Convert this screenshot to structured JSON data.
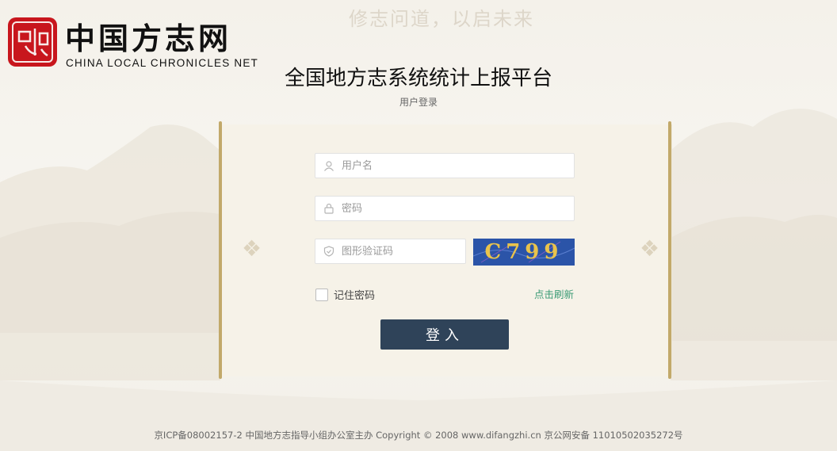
{
  "background": {
    "motto": "修志问道，以启未来"
  },
  "brand": {
    "name_cn": "中国方志网",
    "name_en": "CHINA LOCAL CHRONICLES NET",
    "seal_text": "中國方志"
  },
  "header": {
    "title": "全国地方志系统统计上报平台",
    "subtitle": "用户登录"
  },
  "form": {
    "username_placeholder": "用户名",
    "password_placeholder": "密码",
    "captcha_placeholder": "图形验证码",
    "captcha_image_text": "C799",
    "remember_label": "记住密码",
    "refresh_label": "点击刷新",
    "remember_checked": false,
    "login_label": "登入"
  },
  "footer": {
    "text": "京ICP备08002157-2 中国地方志指导小组办公室主办 Copyright © 2008 www.difangzhi.cn 京公网安备 11010502035272号"
  },
  "colors": {
    "seal": "#c8161d",
    "scroll_rod": "#c2a96a",
    "login_button": "#2f4359",
    "link": "#3a9a74",
    "captcha_bg": "#2b54a8",
    "captcha_text": "#e9c34c"
  }
}
